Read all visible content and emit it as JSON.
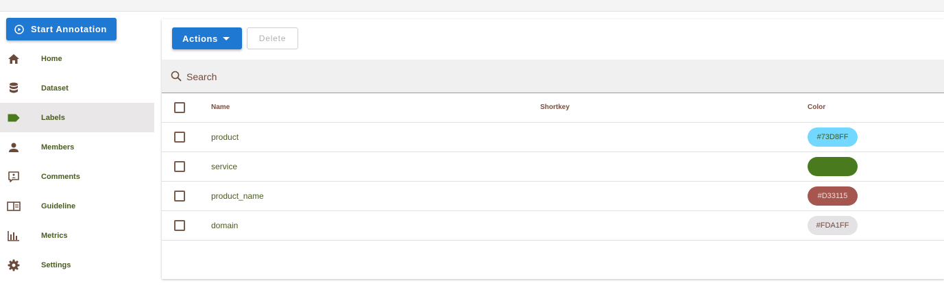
{
  "sidebar": {
    "start_button": "Start Annotation",
    "items": [
      {
        "label": "Home",
        "icon": "home-icon"
      },
      {
        "label": "Dataset",
        "icon": "database-icon"
      },
      {
        "label": "Labels",
        "icon": "label-icon",
        "active": true
      },
      {
        "label": "Members",
        "icon": "person-icon"
      },
      {
        "label": "Comments",
        "icon": "comment-icon"
      },
      {
        "label": "Guideline",
        "icon": "book-icon"
      },
      {
        "label": "Metrics",
        "icon": "chart-bar-icon"
      },
      {
        "label": "Settings",
        "icon": "gear-icon"
      }
    ]
  },
  "toolbar": {
    "actions_label": "Actions",
    "delete_label": "Delete"
  },
  "search": {
    "placeholder": "Search"
  },
  "table": {
    "headers": {
      "name": "Name",
      "shortkey": "Shortkey",
      "color": "Color"
    },
    "rows": [
      {
        "name": "product",
        "shortkey": "",
        "color_text": "#73D8FF",
        "color": "#73D8FF",
        "text_color": "#3a5a1e"
      },
      {
        "name": "service",
        "shortkey": "",
        "color_text": "",
        "color": "#4a7a1e",
        "text_color": "#ffffff"
      },
      {
        "name": "product_name",
        "shortkey": "",
        "color_text": "#D33115",
        "color": "#a5574f",
        "text_color": "#f2dcd8"
      },
      {
        "name": "domain",
        "shortkey": "",
        "color_text": "#FDA1FF",
        "color": "#e4e2e4",
        "text_color": "#6b4a3a"
      }
    ]
  },
  "colors": {
    "primary": "#1f78d1",
    "label_text": "#4a5c1e"
  }
}
